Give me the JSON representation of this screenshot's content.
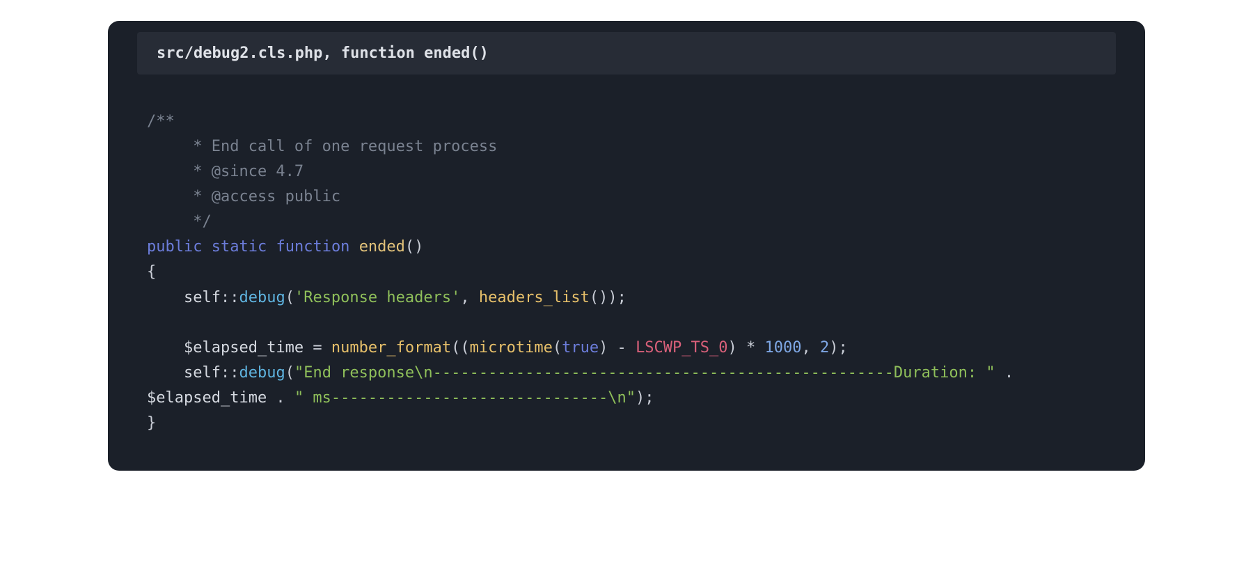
{
  "header": {
    "title": "src/debug2.cls.php, function ended()"
  },
  "code": {
    "comment": {
      "l1": "/**",
      "l2": "     * End call of one request process",
      "l3": "     * @since 4.7",
      "l4": "     * @access public",
      "l5": "     */"
    },
    "kw_public": "public",
    "kw_static": "static",
    "kw_function": "function",
    "fn_ended": "ended",
    "paren_empty": "()",
    "brace_open": "{",
    "self": "self",
    "scope_op": "::",
    "method_debug": "debug",
    "str_response_headers": "'Response headers'",
    "comma_space": ", ",
    "fn_headers_list": "headers_list",
    "paren_close_semicolon": "());",
    "var_elapsed": "$elapsed_time",
    "assign": " = ",
    "fn_number_format": "number_format",
    "paren_open": "(",
    "fn_microtime": "microtime",
    "bool_true": "true",
    "paren_close": ")",
    "minus": " - ",
    "const_lscwp": "LSCWP_TS_0",
    "mul": " * ",
    "num_1000": "1000",
    "num_2": "2",
    "close_semi": ");",
    "paren_open2": "(",
    "str_end_response": "\"End response\\n--------------------------------------------------Duration: \"",
    "concat": " . ",
    "str_ms_tail": "\" ms------------------------------\\n\"",
    "brace_close": "}"
  }
}
